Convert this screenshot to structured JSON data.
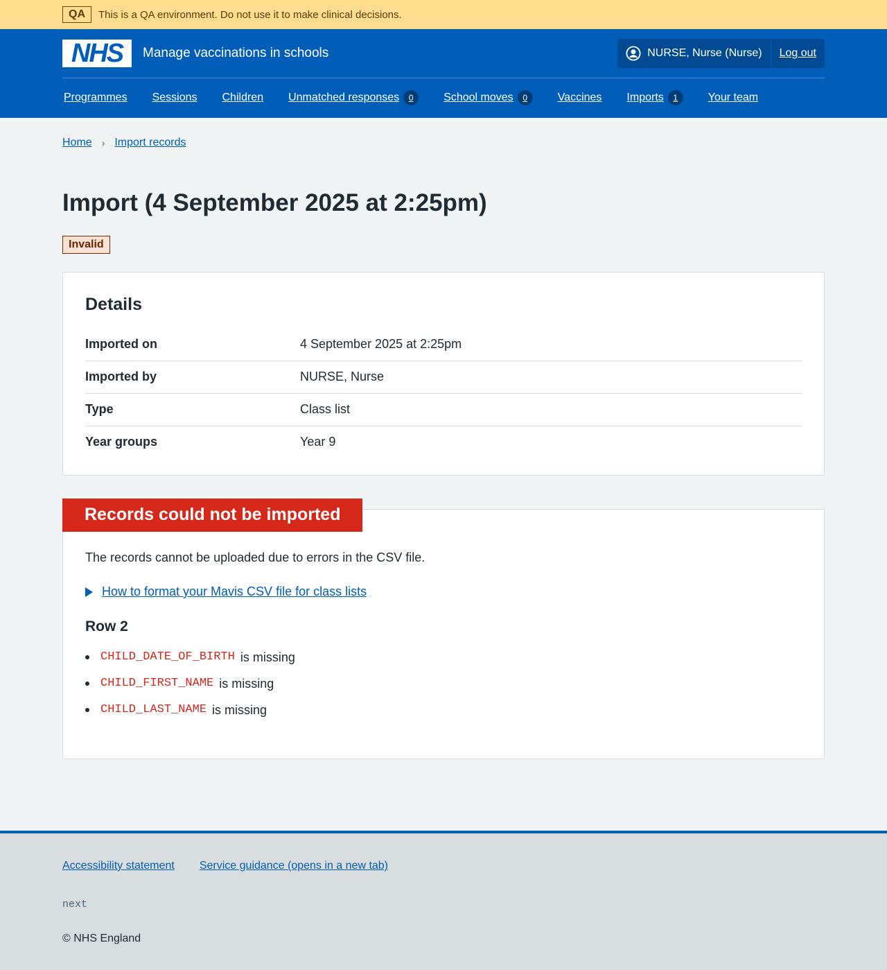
{
  "qa_banner": {
    "tag": "QA",
    "text": "This is a QA environment. Do not use it to make clinical decisions."
  },
  "header": {
    "logo_text": "NHS",
    "service_name": "Manage vaccinations in schools",
    "user": "NURSE, Nurse (Nurse)",
    "logout": "Log out"
  },
  "nav": [
    {
      "label": "Programmes"
    },
    {
      "label": "Sessions"
    },
    {
      "label": "Children"
    },
    {
      "label": "Unmatched responses",
      "count": "0"
    },
    {
      "label": "School moves",
      "count": "0"
    },
    {
      "label": "Vaccines"
    },
    {
      "label": "Imports",
      "count": "1"
    },
    {
      "label": "Your team"
    }
  ],
  "breadcrumb": {
    "home": "Home",
    "imports": "Import records"
  },
  "page_title": "Import (4 September 2025 at 2:25pm)",
  "status_tag": "Invalid",
  "details": {
    "heading": "Details",
    "rows": [
      {
        "key": "Imported on",
        "value": "4 September 2025 at 2:25pm"
      },
      {
        "key": "Imported by",
        "value": "NURSE, Nurse"
      },
      {
        "key": "Type",
        "value": "Class list"
      },
      {
        "key": "Year groups",
        "value": "Year 9"
      }
    ]
  },
  "errors": {
    "heading": "Records could not be imported",
    "description": "The records cannot be uploaded due to errors in the CSV file.",
    "help_link": "How to format your Mavis CSV file for class lists",
    "row_heading": "Row 2",
    "items": [
      {
        "field": "CHILD_DATE_OF_BIRTH",
        "message": "is missing"
      },
      {
        "field": "CHILD_FIRST_NAME",
        "message": "is missing"
      },
      {
        "field": "CHILD_LAST_NAME",
        "message": "is missing"
      }
    ]
  },
  "footer": {
    "accessibility": "Accessibility statement",
    "guidance": "Service guidance (opens in a new tab)",
    "version": "next",
    "copyright": "© NHS England"
  },
  "colors": {
    "brand": "#005eb8",
    "error": "#d5281b",
    "qa_banner": "#ffdc8e"
  },
  "icons": {
    "user": "user-circle-icon",
    "disclosure": "triangle-right-icon"
  }
}
